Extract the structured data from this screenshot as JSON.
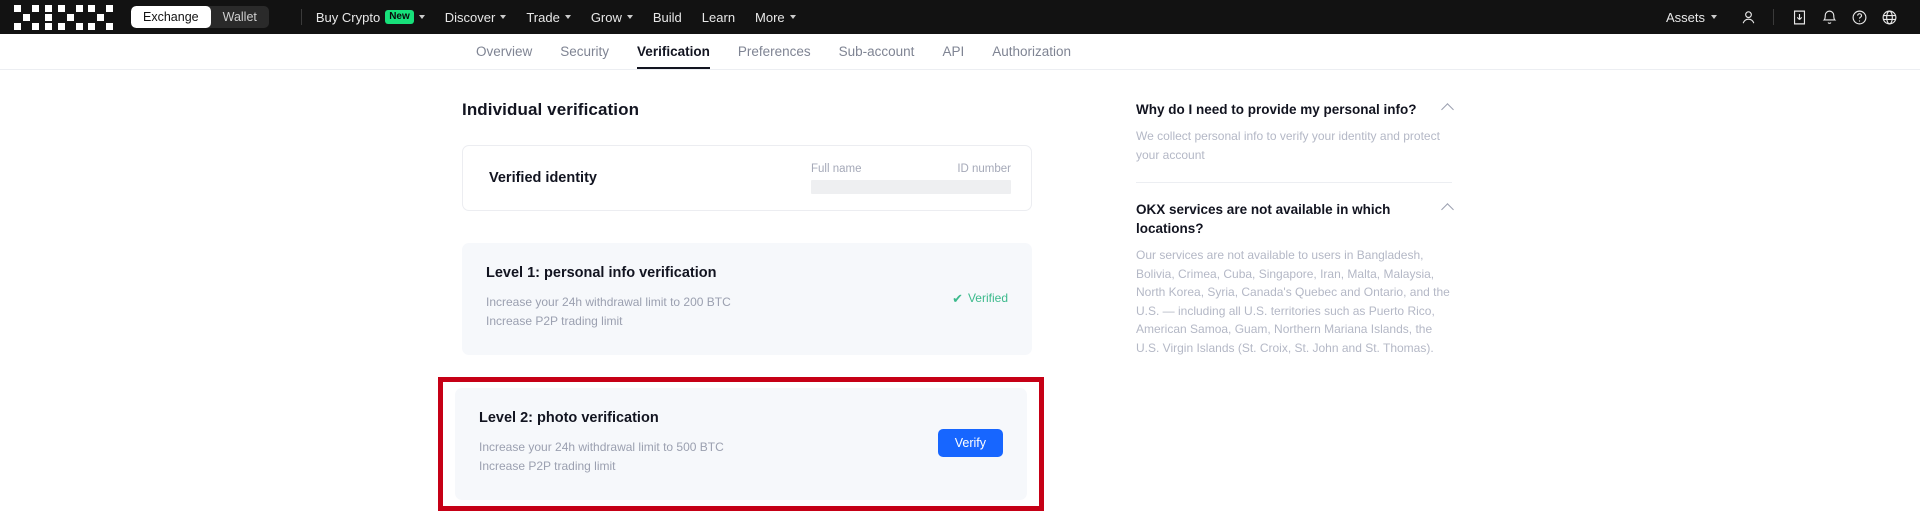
{
  "topbar": {
    "logo_name": "okx-logo",
    "segments": [
      {
        "label": "Exchange",
        "active": true
      },
      {
        "label": "Wallet",
        "active": false
      }
    ],
    "nav": [
      {
        "label": "Buy Crypto",
        "badge": "New",
        "caret": true
      },
      {
        "label": "Discover",
        "badge": "",
        "caret": true
      },
      {
        "label": "Trade",
        "badge": "",
        "caret": true
      },
      {
        "label": "Grow",
        "badge": "",
        "caret": true
      },
      {
        "label": "Build",
        "badge": "",
        "caret": false
      },
      {
        "label": "Learn",
        "badge": "",
        "caret": false
      },
      {
        "label": "More",
        "badge": "",
        "caret": true
      }
    ],
    "assets_label": "Assets",
    "icons": [
      "user-icon",
      "download-icon",
      "bell-icon",
      "help-icon",
      "globe-icon"
    ]
  },
  "tabs": [
    {
      "label": "Overview",
      "active": false
    },
    {
      "label": "Security",
      "active": false
    },
    {
      "label": "Verification",
      "active": true
    },
    {
      "label": "Preferences",
      "active": false
    },
    {
      "label": "Sub-account",
      "active": false
    },
    {
      "label": "API",
      "active": false
    },
    {
      "label": "Authorization",
      "active": false
    }
  ],
  "main": {
    "page_title": "Individual verification",
    "identity": {
      "title": "Verified identity",
      "full_name_label": "Full name",
      "id_number_label": "ID number",
      "full_name_value": "",
      "id_number_value": ""
    },
    "levels": [
      {
        "title": "Level 1: personal info verification",
        "line1": "Increase your 24h withdrawal limit to 200 BTC",
        "line2": "Increase P2P trading limit",
        "status_label": "Verified",
        "highlighted": false
      },
      {
        "title": "Level 2: photo verification",
        "line1": "Increase your 24h withdrawal limit to 500 BTC",
        "line2": "Increase P2P trading limit",
        "action_label": "Verify",
        "highlighted": true
      }
    ]
  },
  "faq": [
    {
      "question": "Why do I need to provide my personal info?",
      "answer": "We collect personal info to verify your identity and protect your account"
    },
    {
      "question": "OKX services are not available in which locations?",
      "answer": "Our services are not available to users in Bangladesh, Bolivia, Crimea, Cuba, Singapore, Iran, Malta, Malaysia, North Korea, Syria, Canada's Quebec and Ontario, and the U.S. — including all U.S. territories such as Puerto Rico, American Samoa, Guam, Northern Mariana Islands, the U.S. Virgin Islands (St. Croix, St. John and St. Thomas)."
    }
  ],
  "colors": {
    "accent_blue": "#1766ff",
    "verified_green": "#3cba8c",
    "highlight_red": "#c60016",
    "topbar_black": "#121212",
    "badge_green": "#17e07a"
  }
}
